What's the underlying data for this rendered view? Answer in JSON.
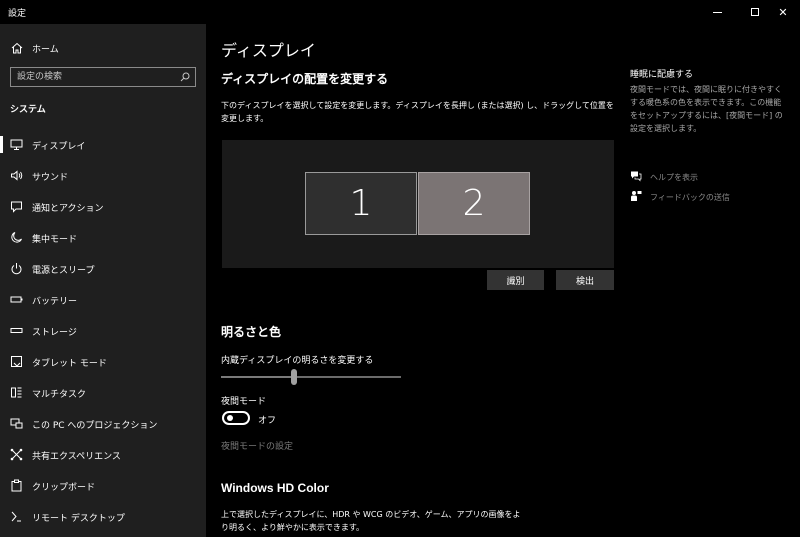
{
  "window": {
    "title": "設定",
    "minimize_glyph": "",
    "maximize_glyph": "",
    "close_glyph": "✕"
  },
  "sidebar": {
    "home_label": "ホーム",
    "search_placeholder": "設定の検索",
    "section_label": "システム",
    "items": [
      {
        "label": "ディスプレイ",
        "icon": "monitor-icon",
        "active": true
      },
      {
        "label": "サウンド",
        "icon": "speaker-icon"
      },
      {
        "label": "通知とアクション",
        "icon": "notification-icon"
      },
      {
        "label": "集中モード",
        "icon": "moon-icon"
      },
      {
        "label": "電源とスリープ",
        "icon": "power-icon"
      },
      {
        "label": "バッテリー",
        "icon": "battery-icon"
      },
      {
        "label": "ストレージ",
        "icon": "storage-icon"
      },
      {
        "label": "タブレット モード",
        "icon": "tablet-icon"
      },
      {
        "label": "マルチタスク",
        "icon": "multitask-icon"
      },
      {
        "label": "この PC へのプロジェクション",
        "icon": "projection-icon"
      },
      {
        "label": "共有エクスペリエンス",
        "icon": "shared-icon"
      },
      {
        "label": "クリップボード",
        "icon": "clipboard-icon"
      },
      {
        "label": "リモート デスクトップ",
        "icon": "remote-desktop-icon"
      }
    ]
  },
  "main": {
    "page_title": "ディスプレイ",
    "arrange_heading": "ディスプレイの配置を変更する",
    "arrange_desc": "下のディスプレイを選択して設定を変更します。ディスプレイを長押し (または選択) し、ドラッグして位置を変更します。",
    "monitor1": "1",
    "monitor2": "2",
    "identify_button": "識別",
    "detect_button": "検出",
    "brightness_heading": "明るさと色",
    "brightness_label": "内蔵ディスプレイの明るさを変更する",
    "brightness_value": 0.4,
    "night_label": "夜間モード",
    "night_state": "オフ",
    "night_settings_link": "夜間モードの設定",
    "hd_heading": "Windows HD Color",
    "hd_desc": "上で選択したディスプレイに、HDR や WCG のビデオ、ゲーム、アプリの画像をより明るく、より鮮やかに表示できます。"
  },
  "right": {
    "title": "睡眠に配慮する",
    "desc": "夜間モードでは、夜間に眠りに付きやすくする暖色系の色を表示できます。この機能をセットアップするには、[夜間モード] の設定を選択します。",
    "help_link": "ヘルプを表示",
    "feedback_link": "フィードバックの送信"
  },
  "colors": {
    "sidebar_bg": "#1f1f1f",
    "main_bg": "#000000",
    "monitor_selected": "#7b7474",
    "monitor_other": "#2f2f2f"
  }
}
